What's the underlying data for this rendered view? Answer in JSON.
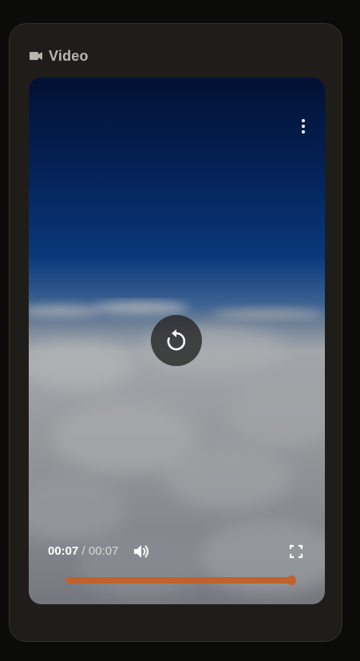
{
  "card": {
    "title": "Video",
    "icon": "video-camera-icon"
  },
  "player": {
    "current_time": "00:07",
    "separator": " / ",
    "duration": "00:07",
    "progress_fraction": 1.0,
    "center_action_icon": "replay-icon",
    "menu_icon": "more-vertical-icon",
    "volume_icon": "volume-icon",
    "fullscreen_icon": "fullscreen-icon",
    "accent_color": "#c0622c"
  },
  "colors": {
    "page_background": "#0b0b09",
    "card_background": "#1f1d1a",
    "title_color": "#b9b6b0"
  }
}
